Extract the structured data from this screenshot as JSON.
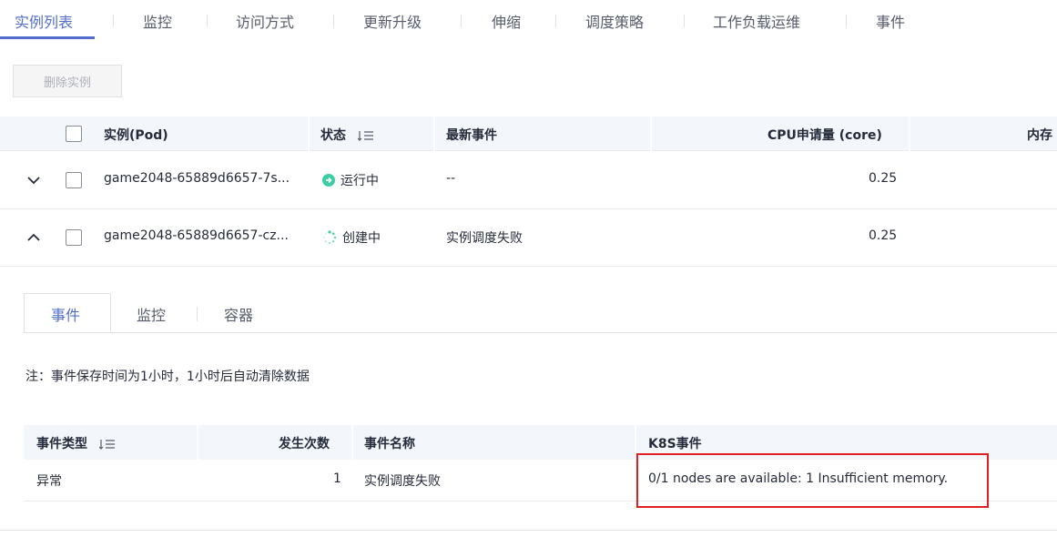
{
  "top_tabs": [
    {
      "label": "实例列表",
      "active": true
    },
    {
      "label": "监控"
    },
    {
      "label": "访问方式"
    },
    {
      "label": "更新升级"
    },
    {
      "label": "伸缩"
    },
    {
      "label": "调度策略"
    },
    {
      "label": "工作负载运维"
    },
    {
      "label": "事件"
    }
  ],
  "toolbar": {
    "delete_label": "删除实例"
  },
  "table": {
    "headers": {
      "pod": "实例(Pod)",
      "status": "状态",
      "event": "最新事件",
      "cpu": "CPU申请量 (core)",
      "memory": "内存"
    },
    "rows": [
      {
        "pod": "game2048-65889d6657-7s...",
        "status": "运行中",
        "status_color": "#3dcca6",
        "event": "--",
        "cpu": "0.25",
        "expanded": false
      },
      {
        "pod": "game2048-65889d6657-cz...",
        "status": "创建中",
        "status_color": "#3dcca6",
        "event": "实例调度失败",
        "cpu": "0.25",
        "expanded": true
      }
    ]
  },
  "detail": {
    "tabs": [
      {
        "label": "事件",
        "active": true
      },
      {
        "label": "监控"
      },
      {
        "label": "容器"
      }
    ],
    "note": "注：事件保存时间为1小时，1小时后自动清除数据",
    "events_table": {
      "headers": {
        "type": "事件类型",
        "count": "发生次数",
        "name": "事件名称",
        "k8s": "K8S事件"
      },
      "rows": [
        {
          "type": "异常",
          "count": "1",
          "name": "实例调度失败",
          "k8s": "0/1 nodes are available: 1 Insufficient memory."
        }
      ]
    }
  },
  "colors": {
    "accent": "#526ecc",
    "highlight_border": "#e02020",
    "header_bg": "#f3f6fa"
  }
}
